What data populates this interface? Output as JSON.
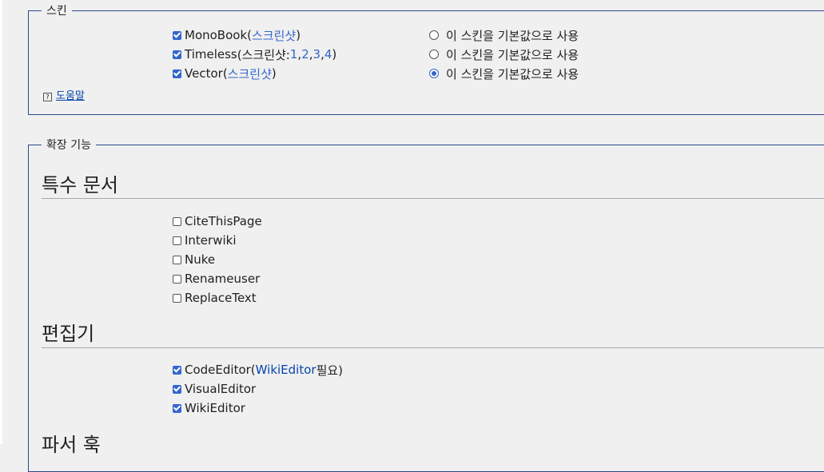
{
  "skin": {
    "legend": "스킨",
    "items": [
      {
        "name": "MonoBook",
        "checked": true,
        "pre": " (",
        "links": [
          "스크린샷"
        ],
        "post": ")",
        "default": false
      },
      {
        "name": "Timeless",
        "checked": true,
        "pre": " (스크린샷: ",
        "links": [
          "1",
          "2",
          "3",
          "4"
        ],
        "post": ")",
        "default": false
      },
      {
        "name": "Vector",
        "checked": true,
        "pre": " (",
        "links": [
          "스크린샷"
        ],
        "post": ")",
        "default": true
      }
    ],
    "default_label": "이 스킨을 기본값으로 사용",
    "help": "도움말"
  },
  "extensions": {
    "legend": "확장 기능",
    "special_pages": {
      "heading": "특수 문서",
      "items": [
        {
          "name": "CiteThisPage",
          "checked": false
        },
        {
          "name": "Interwiki",
          "checked": false
        },
        {
          "name": "Nuke",
          "checked": false
        },
        {
          "name": "Renameuser",
          "checked": false
        },
        {
          "name": "ReplaceText",
          "checked": false
        }
      ]
    },
    "editors": {
      "heading": "편집기",
      "items": [
        {
          "name": "CodeEditor",
          "checked": true,
          "req_pre": " (",
          "req_link": "WikiEditor",
          "req_post": " 필요)"
        },
        {
          "name": "VisualEditor",
          "checked": true
        },
        {
          "name": "WikiEditor",
          "checked": true
        }
      ]
    },
    "parser_hooks": {
      "heading": "파서 훅"
    }
  }
}
